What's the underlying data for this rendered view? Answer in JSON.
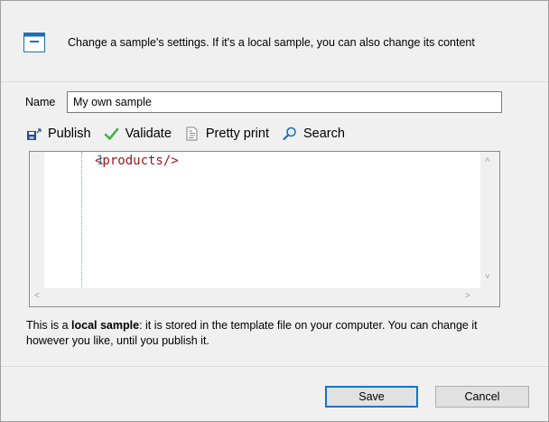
{
  "header": {
    "description": "Change a sample's settings. If it's a local sample, you can also change its content"
  },
  "name_field": {
    "label": "Name",
    "value": "My own sample"
  },
  "toolbar": {
    "publish_label": "Publish",
    "validate_label": "Validate",
    "pretty_print_label": "Pretty print",
    "search_label": "Search"
  },
  "editor": {
    "line_numbers": [
      "1"
    ],
    "code_lines": [
      "<products/>"
    ]
  },
  "info": {
    "prefix": "This is a ",
    "emphasis": "local sample",
    "suffix": ": it is stored in the template file on your computer. You can change it however you like, until you publish it."
  },
  "buttons": {
    "save_label": "Save",
    "cancel_label": "Cancel"
  },
  "colors": {
    "accent": "#0078d7",
    "line_number": "#2b91af",
    "xml_tag": "#a31515",
    "dialog_background": "#f0f0f0"
  },
  "icons": {
    "header": "window-icon",
    "publish": "save-upload-icon",
    "validate": "checkmark-icon",
    "pretty_print": "document-lines-icon",
    "search": "magnifier-icon"
  }
}
